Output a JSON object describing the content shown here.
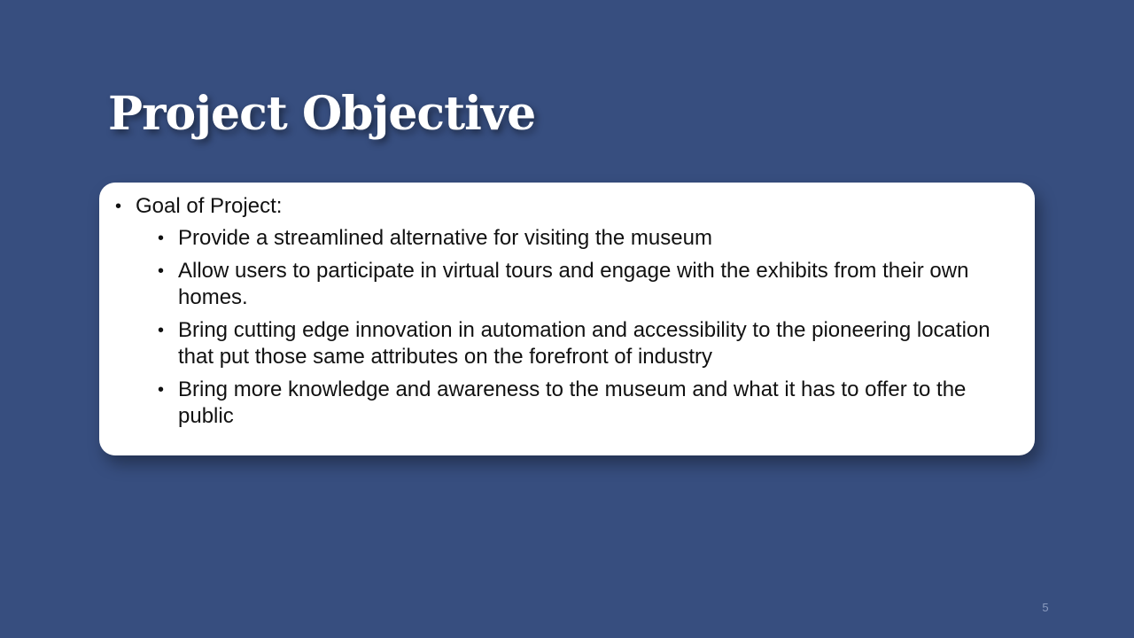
{
  "slide": {
    "title": "Project Objective",
    "page_number": "5",
    "colors": {
      "background": "#374e7f",
      "card": "#ffffff",
      "title_text": "#ffffff",
      "body_text": "#111111"
    },
    "bullet_glyph": "•",
    "content": {
      "heading": "Goal of Project:",
      "items": [
        "Provide a streamlined alternative for visiting the museum",
        "Allow users to participate in virtual tours and engage with the exhibits from their own homes.",
        "Bring cutting edge innovation in automation and accessibility to the pioneering location that put those same attributes on the forefront of industry",
        "Bring more knowledge and awareness to the museum and what it has to offer to the public"
      ]
    }
  }
}
